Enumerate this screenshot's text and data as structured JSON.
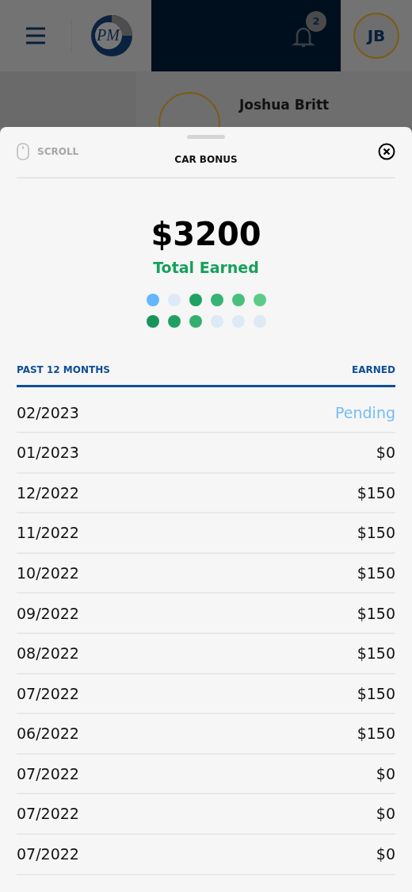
{
  "header": {
    "notification_count": "2",
    "avatar_initials": "JB"
  },
  "logo": {
    "text": "PM"
  },
  "profile": {
    "name": "Joshua Britt"
  },
  "sheet": {
    "scroll_hint": "SCROLL",
    "title": "CAR BONUS",
    "total": "$3200",
    "total_label": "Total Earned",
    "dots": [
      {
        "color": "#66b6fb"
      },
      {
        "color": "#dde9f5"
      },
      {
        "color": "#1fa164"
      },
      {
        "color": "#35b374"
      },
      {
        "color": "#47c07d"
      },
      {
        "color": "#5acc88"
      },
      {
        "color": "#17955a"
      },
      {
        "color": "#22a064"
      },
      {
        "color": "#33b070"
      },
      {
        "color": "#dde9f5"
      },
      {
        "color": "#dde9f5"
      },
      {
        "color": "#dde9f5"
      }
    ],
    "table": {
      "columns": [
        "PAST 12 MONTHS",
        "EARNED"
      ],
      "rows": [
        {
          "month": "02/2023",
          "earned": "Pending",
          "kind": "pending"
        },
        {
          "month": "01/2023",
          "earned": "$0",
          "kind": "amount"
        },
        {
          "month": "12/2022",
          "earned": "$150",
          "kind": "amount"
        },
        {
          "month": "11/2022",
          "earned": "$150",
          "kind": "amount"
        },
        {
          "month": "10/2022",
          "earned": "$150",
          "kind": "amount"
        },
        {
          "month": "09/2022",
          "earned": "$150",
          "kind": "amount"
        },
        {
          "month": "08/2022",
          "earned": "$150",
          "kind": "amount"
        },
        {
          "month": "07/2022",
          "earned": "$150",
          "kind": "amount"
        },
        {
          "month": "06/2022",
          "earned": "$150",
          "kind": "amount"
        },
        {
          "month": "07/2022",
          "earned": "$0",
          "kind": "amount"
        },
        {
          "month": "07/2022",
          "earned": "$0",
          "kind": "amount"
        },
        {
          "month": "07/2022",
          "earned": "$0",
          "kind": "amount"
        }
      ]
    }
  }
}
